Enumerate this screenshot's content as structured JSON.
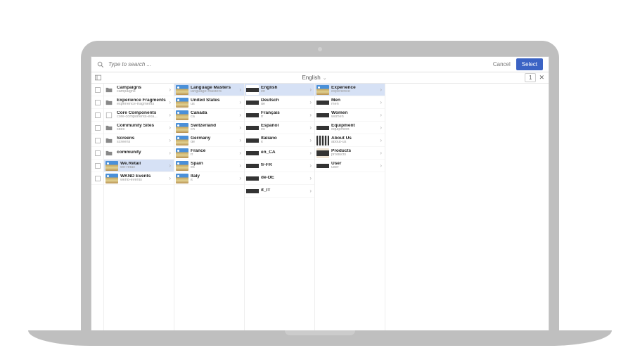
{
  "search": {
    "placeholder": "Type to search ..."
  },
  "actions": {
    "cancel": "Cancel",
    "select": "Select"
  },
  "breadcrumb": {
    "label": "English",
    "count": "1"
  },
  "columns": [
    {
      "items": [
        {
          "title": "Campaigns",
          "sub": "campaigns",
          "icon": "folder"
        },
        {
          "title": "Experience Fragments",
          "sub": "experience-fragments",
          "icon": "folder"
        },
        {
          "title": "Core Components",
          "sub": "core-components-exa...",
          "icon": "box"
        },
        {
          "title": "Community Sites",
          "sub": "sites",
          "icon": "folder"
        },
        {
          "title": "Screens",
          "sub": "screens",
          "icon": "folder"
        },
        {
          "title": "community",
          "sub": "",
          "icon": "folder"
        },
        {
          "title": "We.Retail",
          "sub": "we-retail",
          "thumb": "th-sky",
          "selected": true
        },
        {
          "title": "WKND Events",
          "sub": "wknd-events",
          "thumb": "th-sky"
        }
      ]
    },
    {
      "items": [
        {
          "title": "Language Masters",
          "sub": "language-masters",
          "thumb": "th-sky",
          "selected": true
        },
        {
          "title": "United States",
          "sub": "us",
          "thumb": "th-sky"
        },
        {
          "title": "Canada",
          "sub": "ca",
          "thumb": "th-sky"
        },
        {
          "title": "Switzerland",
          "sub": "ch",
          "thumb": "th-sky"
        },
        {
          "title": "Germany",
          "sub": "de",
          "thumb": "th-sky"
        },
        {
          "title": "France",
          "sub": "fr",
          "thumb": "th-sky"
        },
        {
          "title": "Spain",
          "sub": "es",
          "thumb": "th-sky"
        },
        {
          "title": "Italy",
          "sub": "it",
          "thumb": "th-sky"
        }
      ]
    },
    {
      "items": [
        {
          "title": "English",
          "sub": "en",
          "thumb": "th-dark",
          "selected": true
        },
        {
          "title": "Deutsch",
          "sub": "de",
          "thumb": "th-dark"
        },
        {
          "title": "Français",
          "sub": "fr",
          "thumb": "th-dark"
        },
        {
          "title": "Español",
          "sub": "es",
          "thumb": "th-dark"
        },
        {
          "title": "Italiano",
          "sub": "it",
          "thumb": "th-dark"
        },
        {
          "title": "en_CA",
          "sub": "",
          "thumb": "th-dark"
        },
        {
          "title": "fr-FR",
          "sub": "",
          "thumb": "th-dark"
        },
        {
          "title": "de-DE",
          "sub": "",
          "thumb": "th-dark"
        },
        {
          "title": "it_IT",
          "sub": "",
          "thumb": "th-dark"
        }
      ]
    },
    {
      "items": [
        {
          "title": "Experience",
          "sub": "experience",
          "thumb": "th-sky",
          "selected": true
        },
        {
          "title": "Men",
          "sub": "men",
          "thumb": "th-dark"
        },
        {
          "title": "Women",
          "sub": "women",
          "thumb": "th-dark"
        },
        {
          "title": "Equipment",
          "sub": "equipment",
          "thumb": "th-dark"
        },
        {
          "title": "About Us",
          "sub": "about-us",
          "thumb": "th-strip"
        },
        {
          "title": "Products",
          "sub": "products",
          "thumb": "th-keys"
        },
        {
          "title": "User",
          "sub": "user",
          "thumb": "th-dark"
        }
      ]
    }
  ]
}
